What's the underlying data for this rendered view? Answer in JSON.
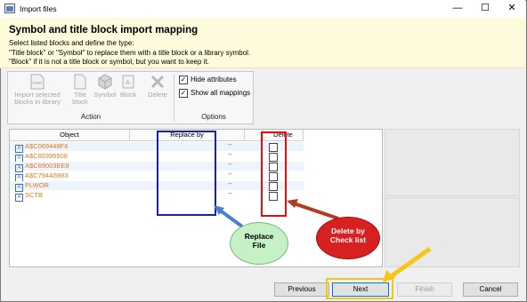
{
  "window": {
    "title": "Import files",
    "minimize": "—",
    "maximize": "☐",
    "close": "✕"
  },
  "header": {
    "title": "Symbol and title block import mapping",
    "lines": [
      "Select listed blocks and define the type:",
      "\"Title block\" or \"Symbol\" to replace them with a title block or a library symbol.",
      "\"Block\" if it is not a title block or symbol, but you want to keep it."
    ]
  },
  "ribbon": {
    "import_label_1": "Import selected",
    "import_label_2": "blocks in library",
    "title_label_1": "Title",
    "title_label_2": "block",
    "symbol_label": "Symbol",
    "block_label": "Block",
    "delete_label": "Delete",
    "action_group": "Action",
    "options_group": "Options",
    "hide_attributes": "Hide attributes",
    "show_all_mappings": "Show all mappings",
    "hide_attributes_checked": true,
    "show_all_mappings_checked": true
  },
  "grid": {
    "columns": [
      "Object",
      "Replace by",
      "",
      "Delete"
    ],
    "rows": [
      {
        "object": "A$C069448F6",
        "replace": "--"
      },
      {
        "object": "A$C60395508",
        "replace": "--"
      },
      {
        "object": "A$C69003EE8",
        "replace": "--"
      },
      {
        "object": "A$C794A5983",
        "replace": "--"
      },
      {
        "object": "PLWOR",
        "replace": "--"
      },
      {
        "object": "SCTB",
        "replace": "--"
      }
    ]
  },
  "callouts": {
    "replace_1": "Replace",
    "replace_2": "File",
    "delete_1": "Delete by",
    "delete_2": "Check list"
  },
  "footer": {
    "previous": "Previous",
    "next": "Next",
    "finish": "Finish",
    "cancel": "Cancel"
  },
  "colors": {
    "blue_box": "#1a1ad0",
    "red_box": "#e01010",
    "gold_highlight": "#f5c518",
    "bubble_fill": "#c6f0c6",
    "object_text": "#e07a1a"
  }
}
